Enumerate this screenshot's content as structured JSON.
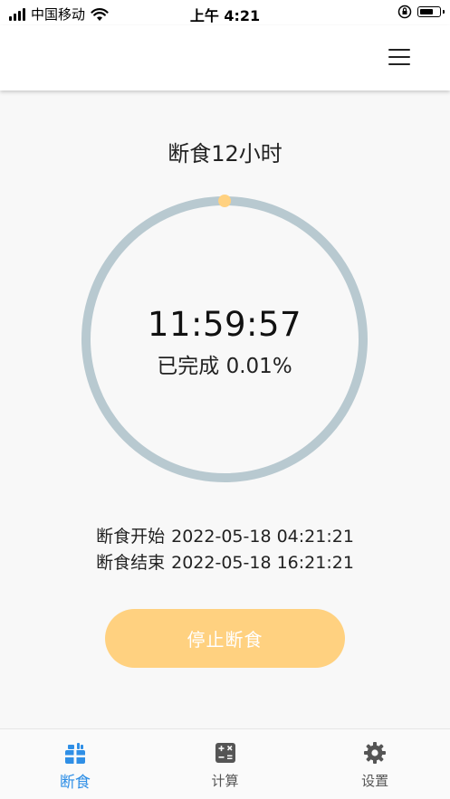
{
  "status_bar": {
    "carrier": "中国移动",
    "time": "上午 4:21"
  },
  "page": {
    "title": "断食12小时"
  },
  "timer": {
    "countdown": "11:59:57",
    "progress_label": "已完成 0.01%",
    "progress_fraction": 0.0001,
    "ring_color": "#b8c9d0",
    "dot_color": "#ffd180"
  },
  "schedule": {
    "start_label": "断食开始",
    "start_time": "2022-05-18 04:21:21",
    "end_label": "断食结束",
    "end_time": "2022-05-18 16:21:21"
  },
  "actions": {
    "stop_label": "停止断食",
    "stop_color": "#ffd180"
  },
  "nav": {
    "active_color": "#2f8fe6",
    "items": [
      {
        "label": "断食",
        "icon": "fasting-icon"
      },
      {
        "label": "计算",
        "icon": "calculator-icon"
      },
      {
        "label": "设置",
        "icon": "gear-icon"
      }
    ]
  }
}
